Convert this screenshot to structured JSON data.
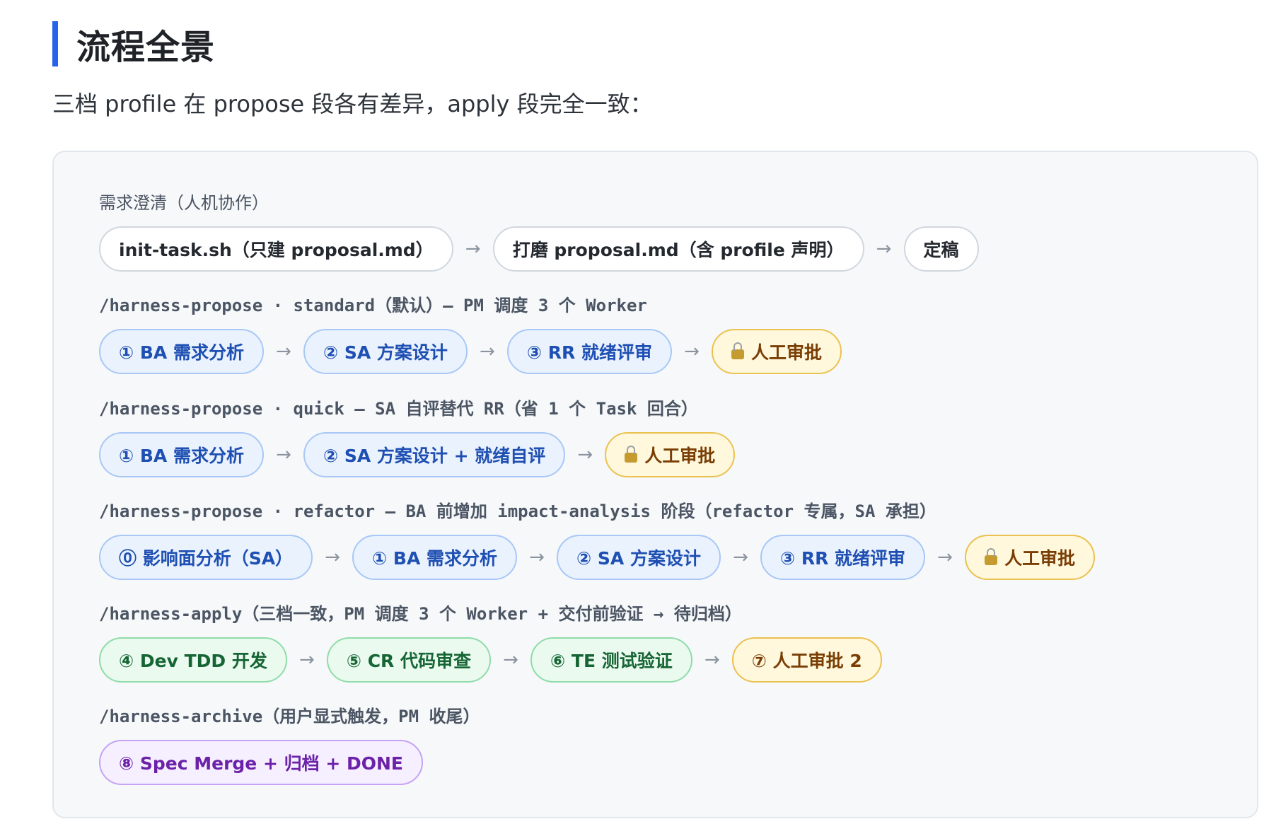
{
  "heading": "流程全景",
  "intro": "三档 profile 在 propose 段各有差异，apply 段完全一致：",
  "arrow_glyph": "→",
  "sections": [
    {
      "label": "需求澄清（人机协作）",
      "steps": [
        {
          "text": "init-task.sh（只建 proposal.md）"
        },
        {
          "text": "打磨 proposal.md（含 profile 声明）"
        },
        {
          "text": "定稿"
        }
      ]
    },
    {
      "label": "/harness-propose · standard（默认）— PM 调度 3 个 Worker",
      "steps": [
        {
          "text": "① BA 需求分析"
        },
        {
          "text": "② SA 方案设计"
        },
        {
          "text": "③ RR 就绪评审"
        },
        {
          "text": "人工审批",
          "icon": "lock-icon"
        }
      ]
    },
    {
      "label": "/harness-propose · quick — SA 自评替代 RR（省 1 个 Task 回合）",
      "steps": [
        {
          "text": "① BA 需求分析"
        },
        {
          "text": "② SA 方案设计 + 就绪自评"
        },
        {
          "text": "人工审批",
          "icon": "lock-icon"
        }
      ]
    },
    {
      "label": "/harness-propose · refactor — BA 前增加 impact-analysis 阶段（refactor 专属，SA 承担）",
      "steps": [
        {
          "text": "⓪ 影响面分析（SA）"
        },
        {
          "text": "① BA 需求分析"
        },
        {
          "text": "② SA 方案设计"
        },
        {
          "text": "③ RR 就绪评审"
        },
        {
          "text": "人工审批",
          "icon": "lock-icon"
        }
      ]
    },
    {
      "label": "/harness-apply（三档一致，PM 调度 3 个 Worker + 交付前验证 → 待归档）",
      "steps": [
        {
          "text": "④ Dev TDD 开发"
        },
        {
          "text": "⑤ CR 代码审查"
        },
        {
          "text": "⑥ TE 测试验证"
        },
        {
          "text": "⑦ 人工审批 2"
        }
      ]
    },
    {
      "label": "/harness-archive（用户显式触发，PM 收尾）",
      "steps": [
        {
          "text": "⑧ Spec Merge + 归档 + DONE"
        }
      ]
    }
  ]
}
